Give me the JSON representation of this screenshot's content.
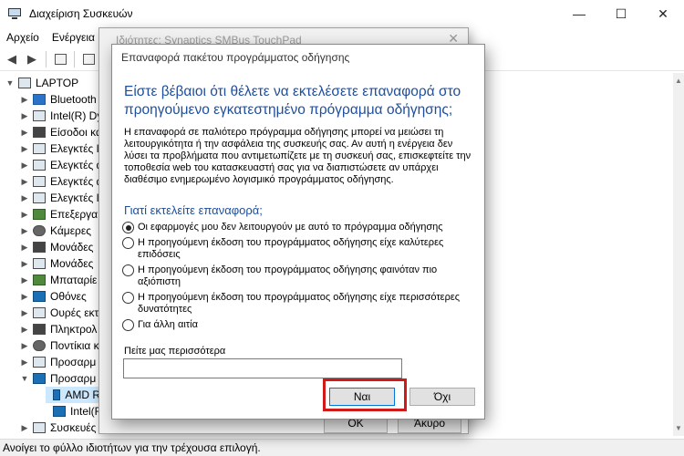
{
  "main_window": {
    "title": "Διαχείριση Συσκευών",
    "controls": [
      "—",
      "☐",
      "✕"
    ]
  },
  "menu": {
    "items": [
      "Αρχείο",
      "Ενέργεια"
    ]
  },
  "toolbar": {
    "buttons": [
      "back-arrow-icon",
      "forward-arrow-icon",
      "properties-icon",
      "help-icon"
    ]
  },
  "tree": {
    "root": "LAPTOP",
    "items": [
      {
        "label": "Bluetooth",
        "icon": "bluetooth-icon"
      },
      {
        "label": "Intel(R) Dy",
        "icon": "chip-icon"
      },
      {
        "label": "Είσοδοι κα",
        "icon": "audio-icon"
      },
      {
        "label": "Ελεγκτές Ι",
        "icon": "controller-icon"
      },
      {
        "label": "Ελεγκτές α",
        "icon": "controller-icon"
      },
      {
        "label": "Ελεγκτές α",
        "icon": "controller-icon"
      },
      {
        "label": "Ελεγκτές I",
        "icon": "controller-icon"
      },
      {
        "label": "Επεξεργα",
        "icon": "processor-icon"
      },
      {
        "label": "Κάμερες",
        "icon": "camera-icon"
      },
      {
        "label": "Μονάδες",
        "icon": "drive-icon"
      },
      {
        "label": "Μονάδες",
        "icon": "drive-icon"
      },
      {
        "label": "Μπαταρίε",
        "icon": "battery-icon"
      },
      {
        "label": "Οθόνες",
        "icon": "monitor-icon"
      },
      {
        "label": "Ουρές εκτ",
        "icon": "printer-icon"
      },
      {
        "label": "Πληκτρολ",
        "icon": "keyboard-icon"
      },
      {
        "label": "Ποντίκια κ",
        "icon": "mouse-icon"
      },
      {
        "label": "Προσαρμ",
        "icon": "adapter-icon"
      },
      {
        "label": "Προσαρμ",
        "icon": "display-adapter-icon"
      },
      {
        "label": "AMD R",
        "icon": "display-adapter-icon"
      },
      {
        "label": "Intel(R)",
        "icon": "display-adapter-icon"
      },
      {
        "label": "Συσκευές",
        "icon": "device-icon"
      }
    ]
  },
  "statusbar": {
    "text": "Ανοίγει το φύλλο ιδιοτήτων για την τρέχουσα επιλογή."
  },
  "properties_dialog": {
    "title": "Ιδιότητες: Synaptics SMBus TouchPad",
    "ok_label": "OK",
    "cancel_label": "Άκυρο"
  },
  "rollback_dialog": {
    "title": "Επαναφορά πακέτου προγράμματος οδήγησης",
    "heading": "Είστε βέβαιοι ότι θέλετε να εκτελέσετε επαναφορά στο προηγούμενο εγκατεστημένο πρόγραμμα οδήγησης;",
    "body": "Η επαναφορά σε παλιότερο πρόγραμμα οδήγησης μπορεί να μειώσει τη λειτουργικότητα ή την ασφάλεια της συσκευής σας. Αν αυτή η ενέργεια δεν λύσει τα προβλήματα που αντιμετωπίζετε με τη συσκευή σας, επισκεφτείτε την τοποθεσία web του κατασκευαστή σας για να διαπιστώσετε αν υπάρχει διαθέσιμο ενημερωμένο λογισμικό προγράμματος οδήγησης.",
    "question": "Γιατί εκτελείτε επαναφορά;",
    "reasons": [
      {
        "label": "Οι εφαρμογές μου δεν λειτουργούν με αυτό το πρόγραμμα οδήγησης",
        "checked": true
      },
      {
        "label": "Η προηγούμενη έκδοση του προγράμματος οδήγησης είχε καλύτερες επιδόσεις",
        "checked": false
      },
      {
        "label": "Η προηγούμενη έκδοση του προγράμματος οδήγησης φαινόταν πιο αξιόπιστη",
        "checked": false
      },
      {
        "label": "Η προηγούμενη έκδοση του προγράμματος οδήγησης είχε περισσότερες δυνατότητες",
        "checked": false
      },
      {
        "label": "Για άλλη αιτία",
        "checked": false
      }
    ],
    "more_label": "Πείτε μας περισσότερα",
    "more_value": "",
    "yes_label": "Ναι",
    "no_label": "Όχι",
    "highlight_color": "#d01a1a"
  }
}
